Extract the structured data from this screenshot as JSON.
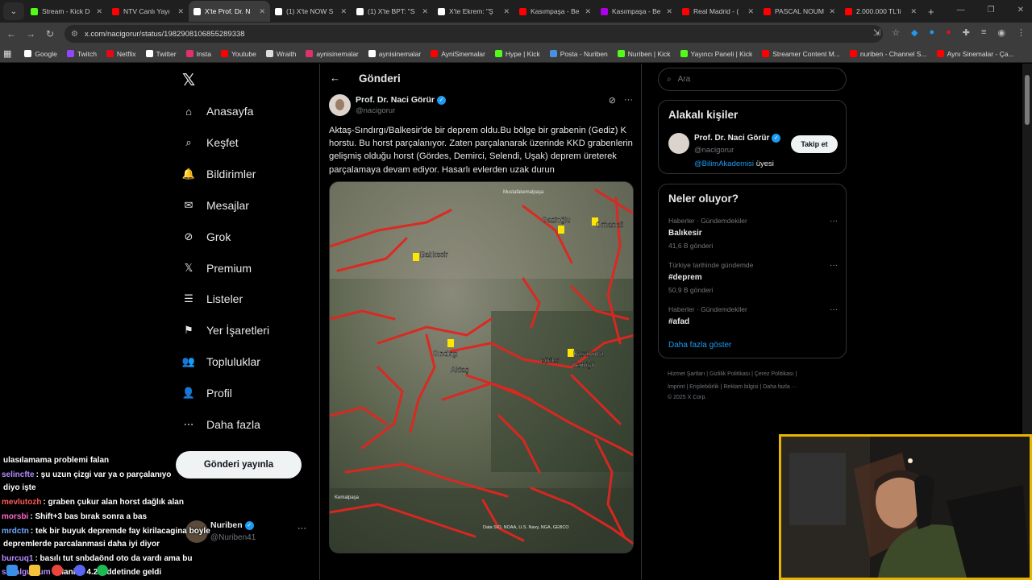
{
  "tabs": [
    {
      "title": "Stream - Kick D",
      "color": "#53fc18"
    },
    {
      "title": "NTV Canlı Yayı",
      "color": "#ff0000"
    },
    {
      "title": "X'te Prof. Dr. N",
      "color": "#ffffff",
      "active": true
    },
    {
      "title": "(1) X'te NOW S",
      "color": "#ffffff"
    },
    {
      "title": "(1) X'te BPT: \"S",
      "color": "#ffffff"
    },
    {
      "title": "X'te Ekrem: \"Ş",
      "color": "#ffffff"
    },
    {
      "title": "Kasımpaşa - Be",
      "color": "#ff0000"
    },
    {
      "title": "Kasımpaşa - Be",
      "color": "#b000e8"
    },
    {
      "title": "Real Madrid - (",
      "color": "#ff0000"
    },
    {
      "title": "PASCAL NOUM",
      "color": "#ff0000"
    },
    {
      "title": "2.000.000 TL'li",
      "color": "#ff0000"
    }
  ],
  "address": {
    "url": "x.com/nacigorur/status/1982908106855289338"
  },
  "bookmarks": [
    {
      "label": "Google",
      "color": "#ffffff"
    },
    {
      "label": "Twitch",
      "color": "#9146ff"
    },
    {
      "label": "Netflix",
      "color": "#e50914"
    },
    {
      "label": "Twitter",
      "color": "#ffffff"
    },
    {
      "label": "Insta",
      "color": "#e1306c"
    },
    {
      "label": "Youtube",
      "color": "#ff0000"
    },
    {
      "label": "Wraith",
      "color": "#dddddd"
    },
    {
      "label": "aynisinemalar",
      "color": "#e1306c"
    },
    {
      "label": "aynisinemalar",
      "color": "#ffffff"
    },
    {
      "label": "AyniSinemalar",
      "color": "#ff0000"
    },
    {
      "label": "Hype | Kick",
      "color": "#53fc18"
    },
    {
      "label": "Posta - Nuriben",
      "color": "#4a90e2"
    },
    {
      "label": "Nuriben | Kick",
      "color": "#53fc18"
    },
    {
      "label": "Yayıncı Paneli | Kick",
      "color": "#53fc18"
    },
    {
      "label": "Streamer Content M...",
      "color": "#ff0000"
    },
    {
      "label": "nuriben - Channel S...",
      "color": "#ff0000"
    },
    {
      "label": "Aynı Sinemalar - Ça...",
      "color": "#ff0000"
    }
  ],
  "sidebar": {
    "items": [
      {
        "label": "Anasayfa",
        "icon": "home-icon",
        "glyph": "⌂"
      },
      {
        "label": "Keşfet",
        "icon": "search-icon",
        "glyph": "⌕"
      },
      {
        "label": "Bildirimler",
        "icon": "bell-icon",
        "glyph": "🔔"
      },
      {
        "label": "Mesajlar",
        "icon": "mail-icon",
        "glyph": "✉"
      },
      {
        "label": "Grok",
        "icon": "grok-icon",
        "glyph": "⊘"
      },
      {
        "label": "Premium",
        "icon": "x-premium-icon",
        "glyph": "𝕏"
      },
      {
        "label": "Listeler",
        "icon": "list-icon",
        "glyph": "☰"
      },
      {
        "label": "Yer İşaretleri",
        "icon": "bookmark-icon",
        "glyph": "⚑"
      },
      {
        "label": "Topluluklar",
        "icon": "community-icon",
        "glyph": "👥"
      },
      {
        "label": "Profil",
        "icon": "profile-icon",
        "glyph": "👤"
      },
      {
        "label": "Daha fazla",
        "icon": "more-icon",
        "glyph": "⋯"
      }
    ],
    "post_button": "Gönderi yayınla",
    "user": {
      "name": "Nuriben",
      "handle": "@Nuriben41"
    }
  },
  "post": {
    "header": "Gönderi",
    "author": "Prof. Dr. Naci Görür",
    "handle": "@nacigorur",
    "text": "Aktaş-Sındırgı/Balkesir'de bir deprem oldu.Bu bölge bir grabenin (Gediz) K horstu. Bu horst parçalanıyor. Zaten parçalanarak üzerinde KKD grabenlerin gelişmiş olduğu horst (Gördes, Demirci, Selendi, Uşak) deprem üreterek parçalamaya devam ediyor.  Hasarlı evlerden uzak durun",
    "map_labels": {
      "balikesir": "Balıkesir",
      "gazioglu": "Gazioğlu",
      "orhaneli": "Orhaneli",
      "sindirgi": "Sındırgı",
      "aktas": "Aktaş",
      "karakoca": "Karakoca",
      "yemisli": "Yemişli",
      "egriler": "eğriler",
      "mustafakemalpasa": "Mustafakemalpaşa",
      "kemalpasa": "Kemalpaşa",
      "credits": "Data SIO, NOAA, U.S. Navy, NGA, GEBCO"
    }
  },
  "right": {
    "search_placeholder": "Ara",
    "related": {
      "title": "Alakalı kişiler",
      "name": "Prof. Dr. Naci Görür",
      "handle": "@nacigorur",
      "follow": "Takip et",
      "member_org": "@BilimAkademisi",
      "member_suffix": " üyesi"
    },
    "trends": {
      "title": "Neler oluyor?",
      "items": [
        {
          "meta": "Haberler · Gündemdekiler",
          "name": "Balıkesir",
          "count": "41,6 B gönderi"
        },
        {
          "meta": "Türkiye tarihinde gündemde",
          "name": "#deprem",
          "count": "50,9 B gönderi"
        },
        {
          "meta": "Haberler · Gündemdekiler",
          "name": "#afad",
          "count": ""
        }
      ],
      "show_more": "Daha fazla göster"
    },
    "footer_1": "Hizmet Şartları  |  Gizlilik Politikası  |  Çerez Politikası  |",
    "footer_2": "İmprint  |  Erişilebilirlik  |  Reklam bilgisi  |  Daha fazla ···",
    "footer_3": "© 2025 X Corp."
  },
  "chat": [
    {
      "user": "",
      "user_color": "#ffffff",
      "msg": "ulasılamama problemi falan"
    },
    {
      "user": "selincfte",
      "user_color": "#b48cff",
      "msg": ": şu uzun çizgi var ya o parçalanıyo"
    },
    {
      "user": "",
      "user_color": "#ffffff",
      "msg": "diyo işte"
    },
    {
      "user": "mevlutozh",
      "user_color": "#ff5a5a",
      "msg": ": graben çukur alan horst dağlık alan"
    },
    {
      "user": "morsbi",
      "user_color": "#ff66cc",
      "msg": ": Shift+3 bas bırak sonra a bas"
    },
    {
      "user": "mrdctn",
      "user_color": "#6fa8ff",
      "msg": ": tek bir buyuk depremde fay kirilacagina boyle"
    },
    {
      "user": "",
      "user_color": "#ffffff",
      "msg": "depremlerde parcalanmasi daha iyi diyor"
    },
    {
      "user": "burcuq1",
      "user_color": "#b48cff",
      "msg": ": basılı tut snbdaönd oto da vardı ama bu"
    },
    {
      "user": "sevalgulsum",
      "user_color": "#b48cff",
      "msg": ": Manisa 4.2 şiddetinde geldi"
    }
  ]
}
